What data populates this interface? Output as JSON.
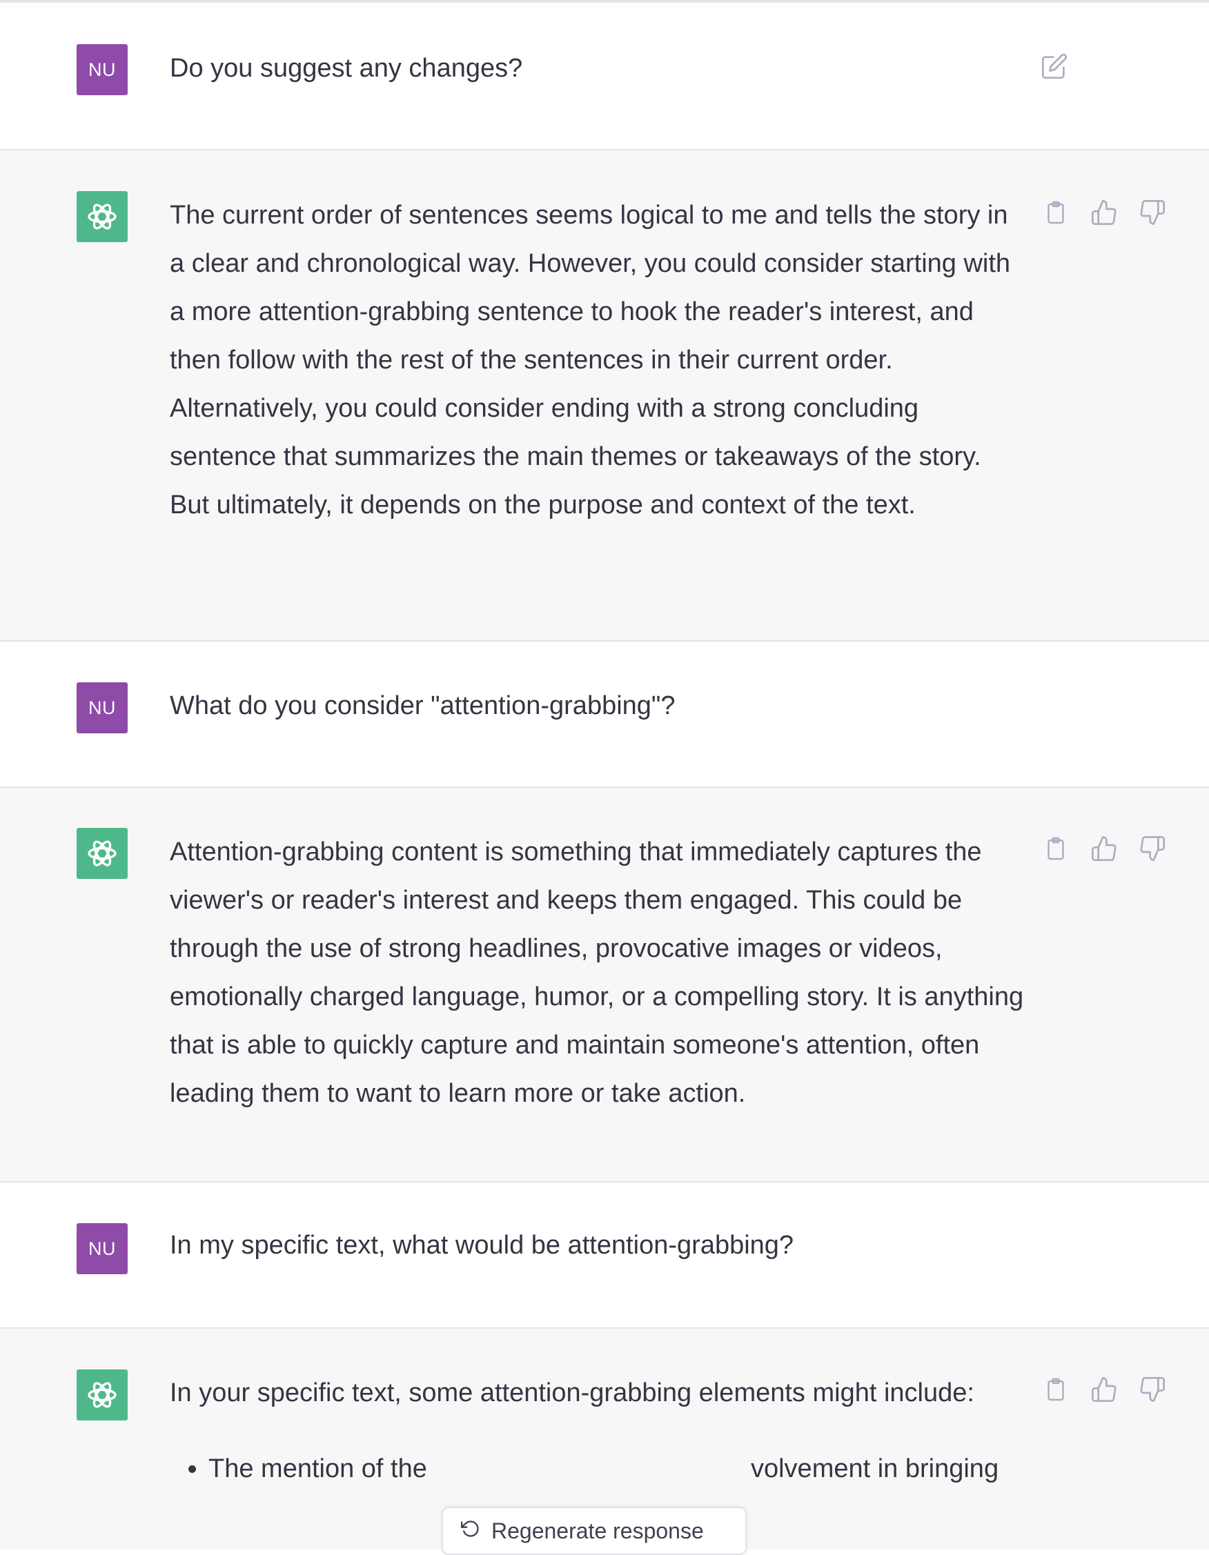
{
  "colors": {
    "user_avatar": "#8e4ba8",
    "assistant_avatar": "#4fb88a",
    "assistant_bg": "#f7f7f8",
    "text": "#343541",
    "icon": "#acacbe"
  },
  "user_avatar_initials": "NU",
  "icons": {
    "edit": "edit-icon",
    "copy": "clipboard-icon",
    "like": "thumbs-up-icon",
    "dislike": "thumbs-down-icon",
    "assistant_logo": "openai-logo-icon",
    "regenerate": "refresh-icon"
  },
  "messages": [
    {
      "role": "user",
      "text": "Do you suggest any changes?"
    },
    {
      "role": "assistant",
      "text": "The current order of sentences seems logical to me and tells the story in a clear and chronological way. However, you could consider starting with a more attention-grabbing sentence to hook the reader's interest, and then follow with the rest of the sentences in their current order. Alternatively, you could consider ending with a strong concluding sentence that summarizes the main themes or takeaways of the story. But ultimately, it depends on the purpose and context of the text."
    },
    {
      "role": "user",
      "text": "What do you consider \"attention-grabbing\"?"
    },
    {
      "role": "assistant",
      "text": "Attention-grabbing content is something that immediately captures the viewer's or reader's interest and keeps them engaged. This could be through the use of strong headlines, provocative images or videos, emotionally charged language, humor, or a compelling story. It is anything that is able to quickly capture and maintain someone's attention, often leading them to want to learn more or take action."
    },
    {
      "role": "user",
      "text": "In my specific text, what would be attention-grabbing?"
    },
    {
      "role": "assistant",
      "text": "In your specific text, some attention-grabbing elements might include:",
      "bullets": [
        "The mention of the",
        "volvement in bringing"
      ]
    }
  ],
  "regenerate_button": {
    "label": "Regenerate response"
  }
}
